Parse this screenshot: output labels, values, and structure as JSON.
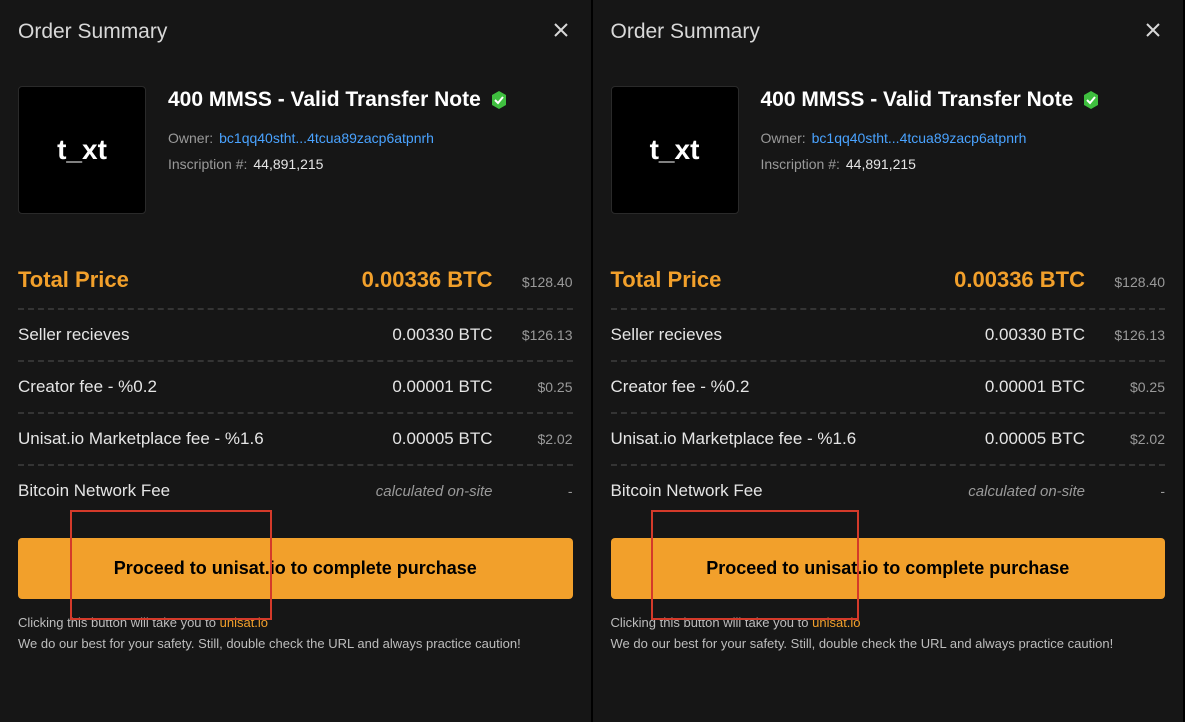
{
  "panel": {
    "title": "Order Summary",
    "item": {
      "thumb_text": "t_xt",
      "title": "400 MMSS - Valid Transfer Note",
      "owner_label": "Owner:",
      "owner_address": "bc1qq40stht...4tcua89zacp6atpnrh",
      "inscription_label": "Inscription #:",
      "inscription_number": "44,891,215"
    },
    "rows": {
      "total": {
        "label": "Total Price",
        "btc": "0.00336 BTC",
        "usd": "$128.40"
      },
      "seller": {
        "label": "Seller recieves",
        "btc": "0.00330 BTC",
        "usd": "$126.13"
      },
      "creator": {
        "label": "Creator fee - %0.2",
        "btc": "0.00001 BTC",
        "usd": "$0.25"
      },
      "market": {
        "label": "Unisat.io Marketplace fee - %1.6",
        "btc": "0.00005 BTC",
        "usd": "$2.02"
      },
      "network": {
        "label": "Bitcoin Network Fee",
        "btc_note": "calculated on-site",
        "usd": "-"
      }
    },
    "proceed_label": "Proceed to unisat.io to complete purchase",
    "disclaimer": {
      "line1_prefix": "Clicking this button will take you to ",
      "line1_link": "unisat.io",
      "line2": "We do our best for your safety. Still, double check the URL and always practice caution!"
    }
  }
}
